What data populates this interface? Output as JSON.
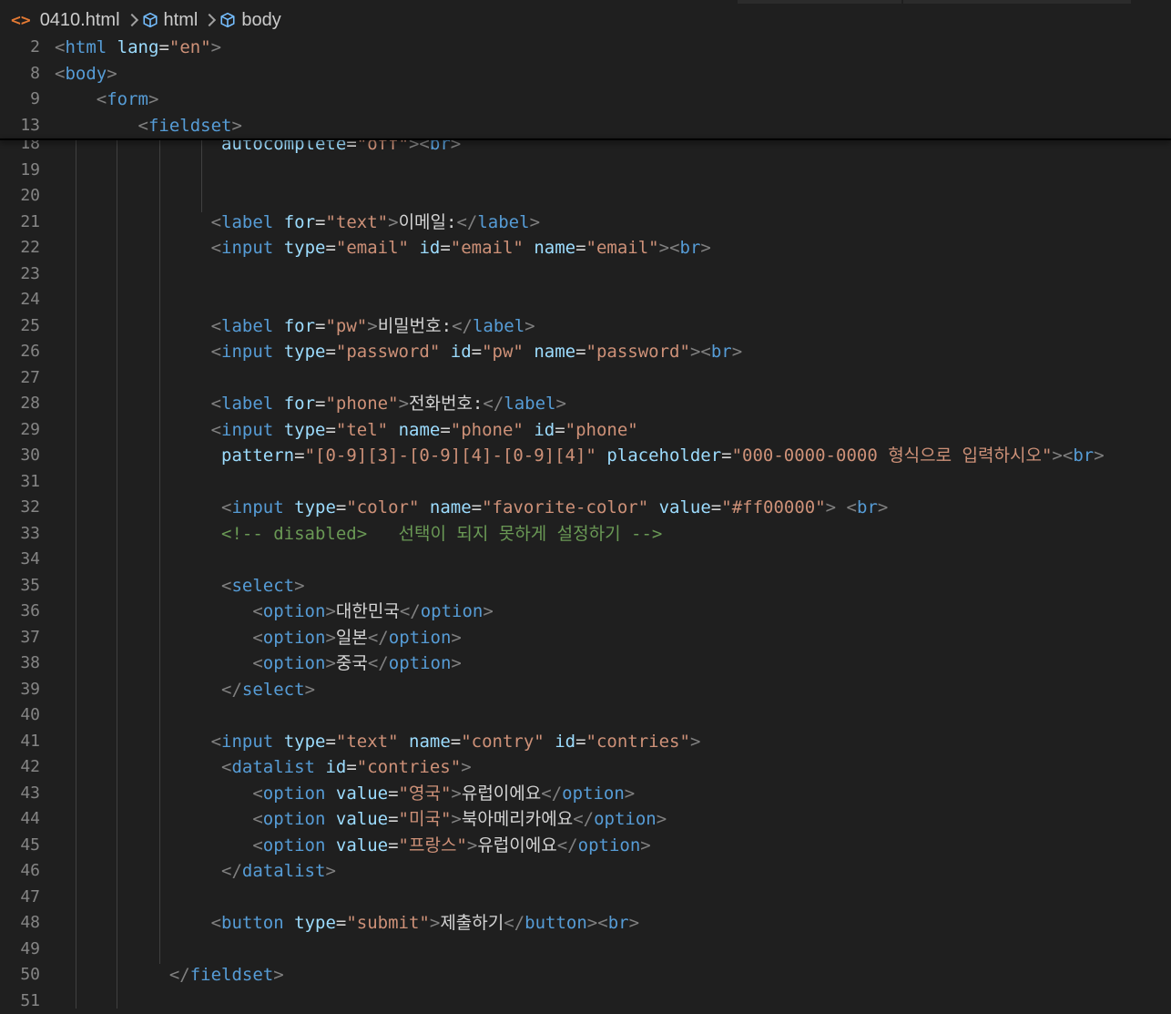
{
  "breadcrumb": {
    "file": "0410.html",
    "items": [
      "html",
      "body"
    ]
  },
  "colors": {
    "background": "#1f1f1f",
    "tag": "#569cd6",
    "attribute": "#9cdcfe",
    "string": "#ce9178",
    "comment": "#6a9955",
    "punctuation": "#808080",
    "text": "#d4d4d4",
    "line_number": "#858585"
  },
  "icons": {
    "file": "html-file-icon",
    "element": "cube-icon",
    "separator": "chevron-right-icon"
  },
  "sticky_lines": [
    {
      "n": "2",
      "tokens": [
        [
          "p",
          "<"
        ],
        [
          "t",
          "html"
        ],
        [
          "x",
          " "
        ],
        [
          "a",
          "lang"
        ],
        [
          "x",
          "="
        ],
        [
          "v",
          "\"en\""
        ],
        [
          "p",
          ">"
        ]
      ]
    },
    {
      "n": "8",
      "tokens": [
        [
          "p",
          "<"
        ],
        [
          "t",
          "body"
        ],
        [
          "p",
          ">"
        ]
      ]
    },
    {
      "n": "9",
      "tokens": [
        [
          "x",
          "    "
        ],
        [
          "p",
          "<"
        ],
        [
          "t",
          "form"
        ],
        [
          "p",
          ">"
        ]
      ]
    },
    {
      "n": "13",
      "tokens": [
        [
          "x",
          "        "
        ],
        [
          "p",
          "<"
        ],
        [
          "t",
          "fieldset"
        ],
        [
          "p",
          ">"
        ]
      ]
    }
  ],
  "lines": [
    {
      "n": "18",
      "tokens": [
        [
          "x",
          "                "
        ],
        [
          "a",
          "autocomplete"
        ],
        [
          "x",
          "="
        ],
        [
          "v",
          "\"off\""
        ],
        [
          "p",
          ">"
        ],
        [
          "p",
          "<"
        ],
        [
          "t",
          "br"
        ],
        [
          "p",
          ">"
        ]
      ]
    },
    {
      "n": "19",
      "tokens": []
    },
    {
      "n": "20",
      "tokens": []
    },
    {
      "n": "21",
      "tokens": [
        [
          "x",
          "               "
        ],
        [
          "p",
          "<"
        ],
        [
          "t",
          "label"
        ],
        [
          "x",
          " "
        ],
        [
          "a",
          "for"
        ],
        [
          "x",
          "="
        ],
        [
          "v",
          "\"text\""
        ],
        [
          "p",
          ">"
        ],
        [
          "x",
          "이메일:"
        ],
        [
          "p",
          "</"
        ],
        [
          "t",
          "label"
        ],
        [
          "p",
          ">"
        ]
      ]
    },
    {
      "n": "22",
      "tokens": [
        [
          "x",
          "               "
        ],
        [
          "p",
          "<"
        ],
        [
          "t",
          "input"
        ],
        [
          "x",
          " "
        ],
        [
          "a",
          "type"
        ],
        [
          "x",
          "="
        ],
        [
          "v",
          "\"email\""
        ],
        [
          "x",
          " "
        ],
        [
          "a",
          "id"
        ],
        [
          "x",
          "="
        ],
        [
          "v",
          "\"email\""
        ],
        [
          "x",
          " "
        ],
        [
          "a",
          "name"
        ],
        [
          "x",
          "="
        ],
        [
          "v",
          "\"email\""
        ],
        [
          "p",
          ">"
        ],
        [
          "p",
          "<"
        ],
        [
          "t",
          "br"
        ],
        [
          "p",
          ">"
        ]
      ]
    },
    {
      "n": "23",
      "tokens": []
    },
    {
      "n": "24",
      "tokens": []
    },
    {
      "n": "25",
      "tokens": [
        [
          "x",
          "               "
        ],
        [
          "p",
          "<"
        ],
        [
          "t",
          "label"
        ],
        [
          "x",
          " "
        ],
        [
          "a",
          "for"
        ],
        [
          "x",
          "="
        ],
        [
          "v",
          "\"pw\""
        ],
        [
          "p",
          ">"
        ],
        [
          "x",
          "비밀번호:"
        ],
        [
          "p",
          "</"
        ],
        [
          "t",
          "label"
        ],
        [
          "p",
          ">"
        ]
      ]
    },
    {
      "n": "26",
      "tokens": [
        [
          "x",
          "               "
        ],
        [
          "p",
          "<"
        ],
        [
          "t",
          "input"
        ],
        [
          "x",
          " "
        ],
        [
          "a",
          "type"
        ],
        [
          "x",
          "="
        ],
        [
          "v",
          "\"password\""
        ],
        [
          "x",
          " "
        ],
        [
          "a",
          "id"
        ],
        [
          "x",
          "="
        ],
        [
          "v",
          "\"pw\""
        ],
        [
          "x",
          " "
        ],
        [
          "a",
          "name"
        ],
        [
          "x",
          "="
        ],
        [
          "v",
          "\"password\""
        ],
        [
          "p",
          ">"
        ],
        [
          "p",
          "<"
        ],
        [
          "t",
          "br"
        ],
        [
          "p",
          ">"
        ]
      ]
    },
    {
      "n": "27",
      "tokens": []
    },
    {
      "n": "28",
      "tokens": [
        [
          "x",
          "               "
        ],
        [
          "p",
          "<"
        ],
        [
          "t",
          "label"
        ],
        [
          "x",
          " "
        ],
        [
          "a",
          "for"
        ],
        [
          "x",
          "="
        ],
        [
          "v",
          "\"phone\""
        ],
        [
          "p",
          ">"
        ],
        [
          "x",
          "전화번호:"
        ],
        [
          "p",
          "</"
        ],
        [
          "t",
          "label"
        ],
        [
          "p",
          ">"
        ]
      ]
    },
    {
      "n": "29",
      "tokens": [
        [
          "x",
          "               "
        ],
        [
          "p",
          "<"
        ],
        [
          "t",
          "input"
        ],
        [
          "x",
          " "
        ],
        [
          "a",
          "type"
        ],
        [
          "x",
          "="
        ],
        [
          "v",
          "\"tel\""
        ],
        [
          "x",
          " "
        ],
        [
          "a",
          "name"
        ],
        [
          "x",
          "="
        ],
        [
          "v",
          "\"phone\""
        ],
        [
          "x",
          " "
        ],
        [
          "a",
          "id"
        ],
        [
          "x",
          "="
        ],
        [
          "v",
          "\"phone\""
        ]
      ]
    },
    {
      "n": "30",
      "tokens": [
        [
          "x",
          "                "
        ],
        [
          "a",
          "pattern"
        ],
        [
          "x",
          "="
        ],
        [
          "v",
          "\"[0-9][3]-[0-9][4]-[0-9][4]\""
        ],
        [
          "x",
          " "
        ],
        [
          "a",
          "placeholder"
        ],
        [
          "x",
          "="
        ],
        [
          "v",
          "\"000-0000-0000 형식으로 입력하시오\""
        ],
        [
          "p",
          ">"
        ],
        [
          "p",
          "<"
        ],
        [
          "t",
          "br"
        ],
        [
          "p",
          ">"
        ]
      ]
    },
    {
      "n": "31",
      "tokens": []
    },
    {
      "n": "32",
      "tokens": [
        [
          "x",
          "                "
        ],
        [
          "p",
          "<"
        ],
        [
          "t",
          "input"
        ],
        [
          "x",
          " "
        ],
        [
          "a",
          "type"
        ],
        [
          "x",
          "="
        ],
        [
          "v",
          "\"color\""
        ],
        [
          "x",
          " "
        ],
        [
          "a",
          "name"
        ],
        [
          "x",
          "="
        ],
        [
          "v",
          "\"favorite-color\""
        ],
        [
          "x",
          " "
        ],
        [
          "a",
          "value"
        ],
        [
          "x",
          "="
        ],
        [
          "v",
          "\"#ff00000\""
        ],
        [
          "p",
          ">"
        ],
        [
          "x",
          " "
        ],
        [
          "p",
          "<"
        ],
        [
          "t",
          "br"
        ],
        [
          "p",
          ">"
        ]
      ]
    },
    {
      "n": "33",
      "tokens": [
        [
          "x",
          "                "
        ],
        [
          "c",
          "<!-- disabled>   선택이 되지 못하게 설정하기 -->"
        ]
      ]
    },
    {
      "n": "34",
      "tokens": []
    },
    {
      "n": "35",
      "tokens": [
        [
          "x",
          "                "
        ],
        [
          "p",
          "<"
        ],
        [
          "t",
          "select"
        ],
        [
          "p",
          ">"
        ]
      ]
    },
    {
      "n": "36",
      "tokens": [
        [
          "x",
          "                   "
        ],
        [
          "p",
          "<"
        ],
        [
          "t",
          "option"
        ],
        [
          "p",
          ">"
        ],
        [
          "x",
          "대한민국"
        ],
        [
          "p",
          "</"
        ],
        [
          "t",
          "option"
        ],
        [
          "p",
          ">"
        ]
      ]
    },
    {
      "n": "37",
      "tokens": [
        [
          "x",
          "                   "
        ],
        [
          "p",
          "<"
        ],
        [
          "t",
          "option"
        ],
        [
          "p",
          ">"
        ],
        [
          "x",
          "일본"
        ],
        [
          "p",
          "</"
        ],
        [
          "t",
          "option"
        ],
        [
          "p",
          ">"
        ]
      ]
    },
    {
      "n": "38",
      "tokens": [
        [
          "x",
          "                   "
        ],
        [
          "p",
          "<"
        ],
        [
          "t",
          "option"
        ],
        [
          "p",
          ">"
        ],
        [
          "x",
          "중국"
        ],
        [
          "p",
          "</"
        ],
        [
          "t",
          "option"
        ],
        [
          "p",
          ">"
        ]
      ]
    },
    {
      "n": "39",
      "tokens": [
        [
          "x",
          "                "
        ],
        [
          "p",
          "</"
        ],
        [
          "t",
          "select"
        ],
        [
          "p",
          ">"
        ]
      ]
    },
    {
      "n": "40",
      "tokens": []
    },
    {
      "n": "41",
      "tokens": [
        [
          "x",
          "               "
        ],
        [
          "p",
          "<"
        ],
        [
          "t",
          "input"
        ],
        [
          "x",
          " "
        ],
        [
          "a",
          "type"
        ],
        [
          "x",
          "="
        ],
        [
          "v",
          "\"text\""
        ],
        [
          "x",
          " "
        ],
        [
          "a",
          "name"
        ],
        [
          "x",
          "="
        ],
        [
          "v",
          "\"contry\""
        ],
        [
          "x",
          " "
        ],
        [
          "a",
          "id"
        ],
        [
          "x",
          "="
        ],
        [
          "v",
          "\"contries\""
        ],
        [
          "p",
          ">"
        ]
      ]
    },
    {
      "n": "42",
      "tokens": [
        [
          "x",
          "                "
        ],
        [
          "p",
          "<"
        ],
        [
          "t",
          "datalist"
        ],
        [
          "x",
          " "
        ],
        [
          "a",
          "id"
        ],
        [
          "x",
          "="
        ],
        [
          "v",
          "\"contries\""
        ],
        [
          "p",
          ">"
        ]
      ]
    },
    {
      "n": "43",
      "tokens": [
        [
          "x",
          "                   "
        ],
        [
          "p",
          "<"
        ],
        [
          "t",
          "option"
        ],
        [
          "x",
          " "
        ],
        [
          "a",
          "value"
        ],
        [
          "x",
          "="
        ],
        [
          "v",
          "\"영국\""
        ],
        [
          "p",
          ">"
        ],
        [
          "x",
          "유럽이에요"
        ],
        [
          "p",
          "</"
        ],
        [
          "t",
          "option"
        ],
        [
          "p",
          ">"
        ]
      ]
    },
    {
      "n": "44",
      "tokens": [
        [
          "x",
          "                   "
        ],
        [
          "p",
          "<"
        ],
        [
          "t",
          "option"
        ],
        [
          "x",
          " "
        ],
        [
          "a",
          "value"
        ],
        [
          "x",
          "="
        ],
        [
          "v",
          "\"미국\""
        ],
        [
          "p",
          ">"
        ],
        [
          "x",
          "북아메리카에요"
        ],
        [
          "p",
          "</"
        ],
        [
          "t",
          "option"
        ],
        [
          "p",
          ">"
        ]
      ]
    },
    {
      "n": "45",
      "tokens": [
        [
          "x",
          "                   "
        ],
        [
          "p",
          "<"
        ],
        [
          "t",
          "option"
        ],
        [
          "x",
          " "
        ],
        [
          "a",
          "value"
        ],
        [
          "x",
          "="
        ],
        [
          "v",
          "\"프랑스\""
        ],
        [
          "p",
          ">"
        ],
        [
          "x",
          "유럽이에요"
        ],
        [
          "p",
          "</"
        ],
        [
          "t",
          "option"
        ],
        [
          "p",
          ">"
        ]
      ]
    },
    {
      "n": "46",
      "tokens": [
        [
          "x",
          "                "
        ],
        [
          "p",
          "</"
        ],
        [
          "t",
          "datalist"
        ],
        [
          "p",
          ">"
        ]
      ]
    },
    {
      "n": "47",
      "tokens": []
    },
    {
      "n": "48",
      "tokens": [
        [
          "x",
          "               "
        ],
        [
          "p",
          "<"
        ],
        [
          "t",
          "button"
        ],
        [
          "x",
          " "
        ],
        [
          "a",
          "type"
        ],
        [
          "x",
          "="
        ],
        [
          "v",
          "\"submit\""
        ],
        [
          "p",
          ">"
        ],
        [
          "x",
          "제출하기"
        ],
        [
          "p",
          "</"
        ],
        [
          "t",
          "button"
        ],
        [
          "p",
          ">"
        ],
        [
          "p",
          "<"
        ],
        [
          "t",
          "br"
        ],
        [
          "p",
          ">"
        ]
      ]
    },
    {
      "n": "49",
      "tokens": []
    },
    {
      "n": "50",
      "tokens": [
        [
          "x",
          "           "
        ],
        [
          "p",
          "</"
        ],
        [
          "t",
          "fieldset"
        ],
        [
          "p",
          ">"
        ]
      ]
    },
    {
      "n": "51",
      "tokens": []
    }
  ]
}
